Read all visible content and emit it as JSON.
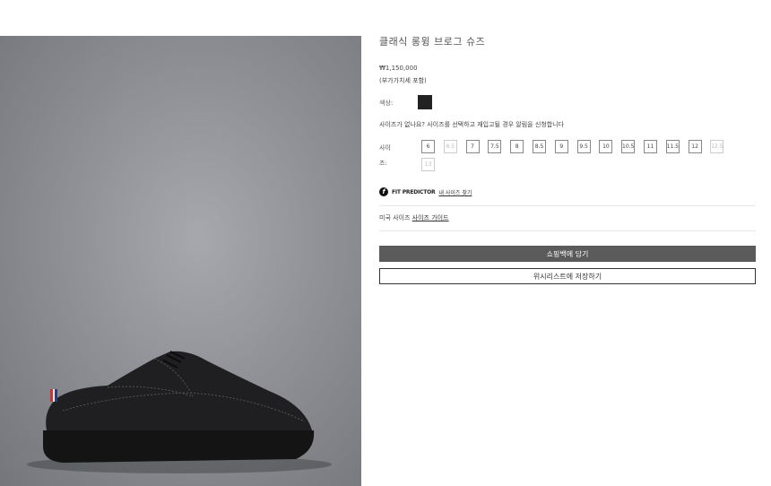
{
  "product": {
    "title": "클래식 롱윙 브로그 슈즈",
    "price": "₩1,150,000",
    "vat_note": "(부가가치세 포함)",
    "image_alt": "black pebble grain longwing brogue shoe"
  },
  "color": {
    "label": "색상:",
    "selected_swatch": "#222222"
  },
  "size": {
    "notice": "사이즈가 없나요? 사이즈를 선택하고 재입고될 경우 알림을 신청합니다",
    "label": "사이즈:",
    "options": [
      {
        "label": "6",
        "available": true
      },
      {
        "label": "6.5",
        "available": false
      },
      {
        "label": "7",
        "available": true
      },
      {
        "label": "7.5",
        "available": true
      },
      {
        "label": "8",
        "available": true
      },
      {
        "label": "8.5",
        "available": true
      },
      {
        "label": "9",
        "available": true
      },
      {
        "label": "9.5",
        "available": true
      },
      {
        "label": "10",
        "available": true
      },
      {
        "label": "10.5",
        "available": true
      },
      {
        "label": "11",
        "available": true
      },
      {
        "label": "11.5",
        "available": true
      },
      {
        "label": "12",
        "available": true
      },
      {
        "label": "12.5",
        "available": false
      },
      {
        "label": "13",
        "available": false
      }
    ]
  },
  "fit_predictor": {
    "brand": "FIT PREDICTOR",
    "link": "내 사이즈 찾기",
    "icon": "fit-predictor-icon"
  },
  "size_guide": {
    "prefix": "미국 사이즈",
    "link": "사이즈 가이드"
  },
  "actions": {
    "add_to_bag": "쇼핑백에 담기",
    "save_wishlist": "위시리스트에 저장하기"
  }
}
